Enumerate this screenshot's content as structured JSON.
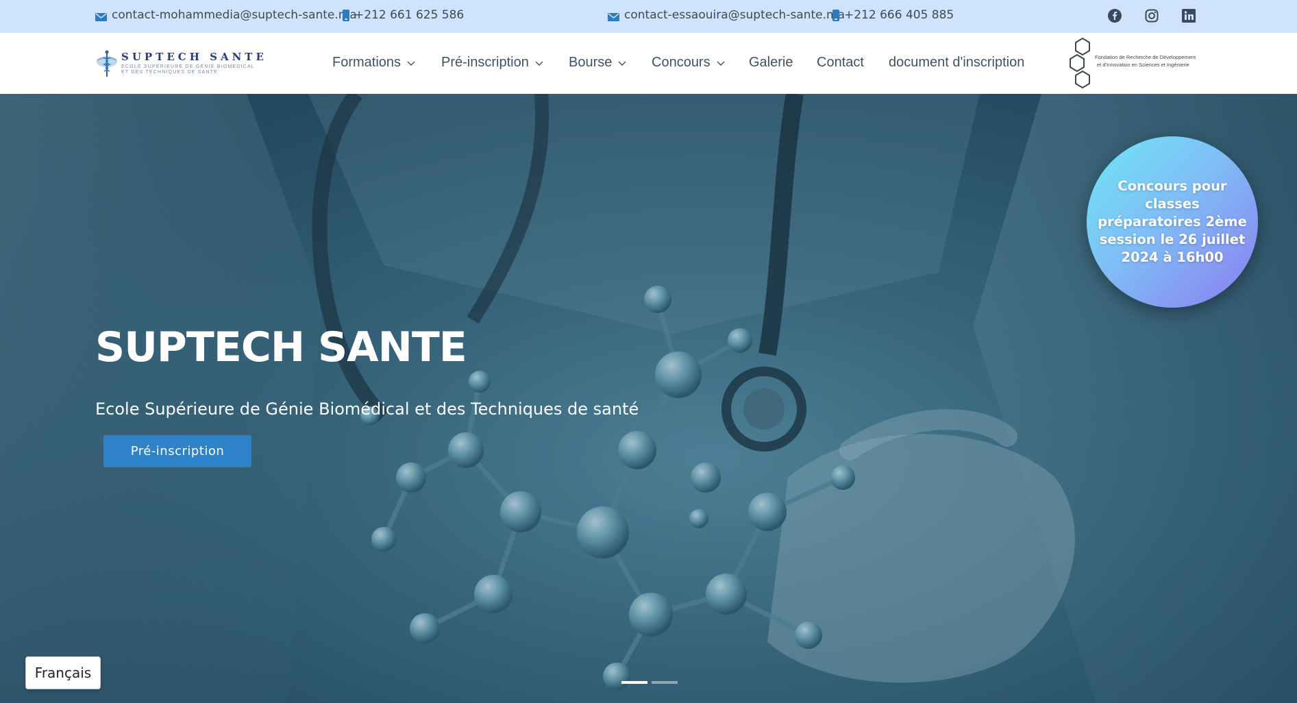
{
  "topbar": {
    "contacts": [
      {
        "email": "contact-mohammedia@suptech-sante.ma",
        "phone": "+212 661 625 586"
      },
      {
        "email": "contact-essaouira@suptech-sante.ma",
        "phone": "+212 666 405 885"
      }
    ],
    "social_icons": [
      "facebook-icon",
      "instagram-icon",
      "linkedin-icon"
    ]
  },
  "brand": {
    "title": "SUPTECH SANTE",
    "subtitle_line1": "ECOLE SUPERIEURE DE GENIE BIOMEDICAL",
    "subtitle_line2": "ET DES TECHNIQUES DE SANTE"
  },
  "nav": {
    "items": [
      {
        "label": "Formations",
        "has_dropdown": true
      },
      {
        "label": "Pré-inscription",
        "has_dropdown": true
      },
      {
        "label": "Bourse",
        "has_dropdown": true
      },
      {
        "label": "Concours",
        "has_dropdown": true
      },
      {
        "label": "Galerie",
        "has_dropdown": false
      },
      {
        "label": "Contact",
        "has_dropdown": false
      },
      {
        "label": "document d'inscription",
        "has_dropdown": false
      }
    ]
  },
  "partner": {
    "line1": "Fondation de Recherche de Développement",
    "line2": "et d'Innovation en Sciences et Ingénierie"
  },
  "hero": {
    "title": "SUPTECH SANTE",
    "subtitle": "Ecole Supérieure de Génie Biomédical et des Techniques de santé",
    "button_label": "Pré-inscription",
    "badge_text": "Concours pour classes préparatoires 2ème session le 26 juillet 2024 à 16h00",
    "slides_count": 2,
    "active_slide": 1
  },
  "language": {
    "selected": "Français"
  },
  "colors": {
    "topbar_bg": "#cfe4fb",
    "nav_text": "#3b5268",
    "accent": "#2e82c8",
    "brand_blue": "#1f3d8a"
  }
}
